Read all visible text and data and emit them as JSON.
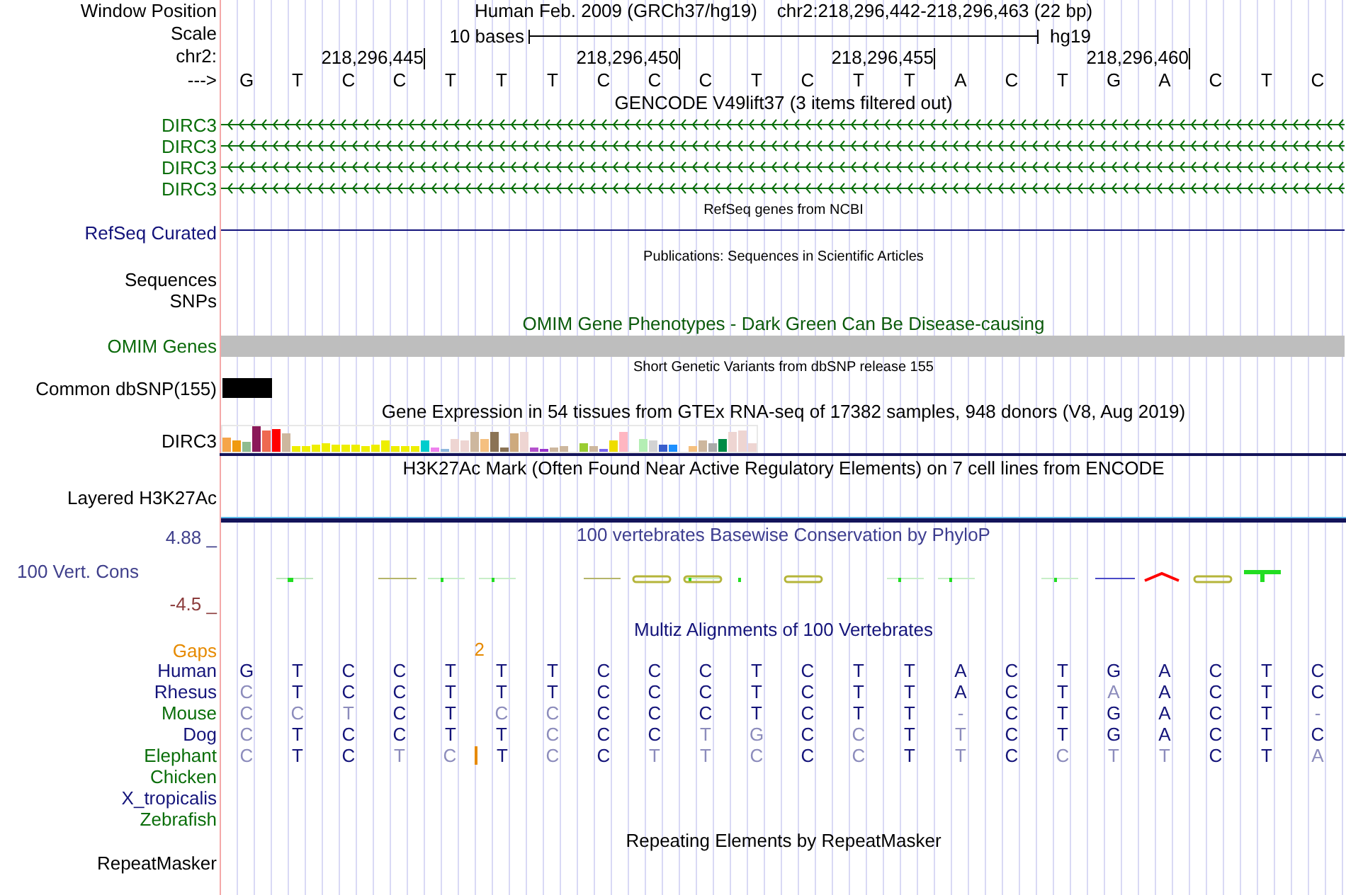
{
  "header": {
    "label": "Window Position",
    "assembly": "Human Feb. 2009 (GRCh37/hg19)",
    "position": "chr2:218,296,442-218,296,463 (22 bp)"
  },
  "scale": {
    "label": "Scale",
    "length": "10 bases",
    "assembly": "hg19"
  },
  "ruler": {
    "label": "chr2:",
    "ticks": [
      "218,296,445",
      "218,296,450",
      "218,296,455",
      "218,296,460"
    ]
  },
  "sequence": {
    "label": "--->",
    "bases": [
      "G",
      "T",
      "C",
      "C",
      "T",
      "T",
      "T",
      "C",
      "C",
      "C",
      "T",
      "C",
      "T",
      "T",
      "A",
      "C",
      "T",
      "G",
      "A",
      "C",
      "T",
      "C"
    ]
  },
  "tracks": [
    {
      "kind": "genes",
      "title": {
        "text": "GENCODE V49lift37 (3 items filtered out)",
        "color": "#000000"
      },
      "compact": false,
      "color": "#0a6e0a",
      "arrows": true,
      "rows": [
        "DIRC3",
        "DIRC3",
        "DIRC3",
        "DIRC3"
      ]
    },
    {
      "kind": "genes",
      "title": {
        "text": "RefSeq genes from NCBI",
        "color": "#000000"
      },
      "compact": true,
      "color": "#12127a",
      "arrows": false,
      "rows": [
        "RefSeq Curated"
      ]
    },
    {
      "kind": "labels",
      "title": {
        "text": "Publications: Sequences in Scientific Articles",
        "color": "#000000"
      },
      "compact": true,
      "rows": [
        "Sequences",
        "SNPs"
      ]
    },
    {
      "kind": "bar",
      "title": {
        "text": "OMIM Gene Phenotypes - Dark Green Can Be Disease-causing",
        "color": "#0b5a0b"
      },
      "compact": false,
      "color": "#0b6a0b",
      "bar": {
        "color": "#bebebe",
        "full": true
      },
      "rows": [
        "OMIM Genes"
      ]
    },
    {
      "kind": "bar",
      "title": {
        "text": "Short Genetic Variants from dbSNP release 155",
        "color": "#000000"
      },
      "compact": true,
      "color": "#000000",
      "bar": {
        "color": "#000000",
        "full": false
      },
      "rows": [
        "Common dbSNP(155)"
      ]
    },
    {
      "kind": "expression",
      "title": {
        "text": "Gene Expression in 54 tissues from GTEx RNA-seq of 17382 samples, 948 donors (V8, Aug 2019)",
        "color": "#000000"
      },
      "compact": false,
      "rows": [
        "DIRC3"
      ]
    },
    {
      "kind": "empty",
      "title": {
        "text": "H3K27Ac Mark (Often Found Near Active Regulatory Elements) on 7 cell lines from ENCODE",
        "color": "#000000"
      },
      "compact": false,
      "rows": [
        "Layered H3K27Ac"
      ]
    },
    {
      "kind": "wiggle",
      "title": {
        "text": "100 vertebrates Basewise Conservation by PhyloP",
        "color": "#3d3d8f"
      },
      "compact": false,
      "max": "4.88 _",
      "label": "100 Vert. Cons",
      "min": "-4.5 _"
    },
    {
      "kind": "alignment",
      "title": {
        "text": "Multiz Alignments of 100 Vertebrates",
        "color": "#14147a"
      },
      "compact": false,
      "gaps_label": "Gaps",
      "species": [
        {
          "name": "Human",
          "color": "#14147a",
          "bases": [
            {
              "base": "G",
              "match": true
            },
            {
              "base": "T",
              "match": true
            },
            {
              "base": "C",
              "match": true
            },
            {
              "base": "C",
              "match": true
            },
            {
              "base": "T",
              "match": true
            },
            {
              "base": "T",
              "match": true
            },
            {
              "base": "T",
              "match": true
            },
            {
              "base": "C",
              "match": true
            },
            {
              "base": "C",
              "match": true
            },
            {
              "base": "C",
              "match": true
            },
            {
              "base": "T",
              "match": true
            },
            {
              "base": "C",
              "match": true
            },
            {
              "base": "T",
              "match": true
            },
            {
              "base": "T",
              "match": true
            },
            {
              "base": "A",
              "match": true
            },
            {
              "base": "C",
              "match": true
            },
            {
              "base": "T",
              "match": true
            },
            {
              "base": "G",
              "match": true
            },
            {
              "base": "A",
              "match": true
            },
            {
              "base": "C",
              "match": true
            },
            {
              "base": "T",
              "match": true
            },
            {
              "base": "C",
              "match": true
            }
          ]
        },
        {
          "name": "Rhesus",
          "color": "#14147a",
          "bases": [
            {
              "base": "C",
              "match": false
            },
            {
              "base": "T",
              "match": true
            },
            {
              "base": "C",
              "match": true
            },
            {
              "base": "C",
              "match": true
            },
            {
              "base": "T",
              "match": true
            },
            {
              "base": "T",
              "match": true
            },
            {
              "base": "T",
              "match": true
            },
            {
              "base": "C",
              "match": true
            },
            {
              "base": "C",
              "match": true
            },
            {
              "base": "C",
              "match": true
            },
            {
              "base": "T",
              "match": true
            },
            {
              "base": "C",
              "match": true
            },
            {
              "base": "T",
              "match": true
            },
            {
              "base": "T",
              "match": true
            },
            {
              "base": "A",
              "match": true
            },
            {
              "base": "C",
              "match": true
            },
            {
              "base": "T",
              "match": true
            },
            {
              "base": "A",
              "match": false
            },
            {
              "base": "A",
              "match": true
            },
            {
              "base": "C",
              "match": true
            },
            {
              "base": "T",
              "match": true
            },
            {
              "base": "C",
              "match": true
            }
          ]
        },
        {
          "name": "Mouse",
          "color": "#0a6e0a",
          "bases": [
            {
              "base": "C",
              "match": false
            },
            {
              "base": "C",
              "match": false
            },
            {
              "base": "T",
              "match": false
            },
            {
              "base": "C",
              "match": true
            },
            {
              "base": "T",
              "match": true
            },
            {
              "base": "C",
              "match": false
            },
            {
              "base": "C",
              "match": false
            },
            {
              "base": "C",
              "match": true
            },
            {
              "base": "C",
              "match": true
            },
            {
              "base": "C",
              "match": true
            },
            {
              "base": "T",
              "match": true
            },
            {
              "base": "C",
              "match": true
            },
            {
              "base": "T",
              "match": true
            },
            {
              "base": "T",
              "match": true
            },
            {
              "base": "-",
              "match": false
            },
            {
              "base": "C",
              "match": true
            },
            {
              "base": "T",
              "match": true
            },
            {
              "base": "G",
              "match": true
            },
            {
              "base": "A",
              "match": true
            },
            {
              "base": "C",
              "match": true
            },
            {
              "base": "T",
              "match": true
            },
            {
              "base": "-",
              "match": false
            }
          ]
        },
        {
          "name": "Dog",
          "color": "#14147a",
          "bases": [
            {
              "base": "C",
              "match": false
            },
            {
              "base": "T",
              "match": true
            },
            {
              "base": "C",
              "match": true
            },
            {
              "base": "C",
              "match": true
            },
            {
              "base": "T",
              "match": true
            },
            {
              "base": "T",
              "match": true
            },
            {
              "base": "C",
              "match": false
            },
            {
              "base": "C",
              "match": true
            },
            {
              "base": "C",
              "match": true
            },
            {
              "base": "T",
              "match": false
            },
            {
              "base": "G",
              "match": false
            },
            {
              "base": "C",
              "match": true
            },
            {
              "base": "C",
              "match": false
            },
            {
              "base": "T",
              "match": true
            },
            {
              "base": "T",
              "match": false
            },
            {
              "base": "C",
              "match": true
            },
            {
              "base": "T",
              "match": true
            },
            {
              "base": "G",
              "match": true
            },
            {
              "base": "A",
              "match": true
            },
            {
              "base": "C",
              "match": true
            },
            {
              "base": "T",
              "match": true
            },
            {
              "base": "C",
              "match": true
            }
          ]
        },
        {
          "name": "Elephant",
          "color": "#0a6e0a",
          "bases": [
            {
              "base": "C",
              "match": false
            },
            {
              "base": "T",
              "match": true
            },
            {
              "base": "C",
              "match": true
            },
            {
              "base": "T",
              "match": false
            },
            {
              "base": "C",
              "match": false,
              "insertion": "2"
            },
            {
              "base": "T",
              "match": true
            },
            {
              "base": "C",
              "match": false
            },
            {
              "base": "C",
              "match": true
            },
            {
              "base": "T",
              "match": false
            },
            {
              "base": "T",
              "match": false
            },
            {
              "base": "C",
              "match": false
            },
            {
              "base": "C",
              "match": true
            },
            {
              "base": "C",
              "match": false
            },
            {
              "base": "T",
              "match": true
            },
            {
              "base": "T",
              "match": false
            },
            {
              "base": "C",
              "match": true
            },
            {
              "base": "C",
              "match": false
            },
            {
              "base": "T",
              "match": false
            },
            {
              "base": "T",
              "match": false
            },
            {
              "base": "C",
              "match": true
            },
            {
              "base": "T",
              "match": true
            },
            {
              "base": "A",
              "match": false
            }
          ]
        },
        {
          "name": "Chicken",
          "color": "#0a6e0a"
        },
        {
          "name": "X_tropicalis",
          "color": "#14147a"
        },
        {
          "name": "Zebrafish",
          "color": "#0a6e0a"
        }
      ]
    },
    {
      "kind": "labels",
      "title": {
        "text": "Repeating Elements by RepeatMasker",
        "color": "#000000"
      },
      "compact": false,
      "rows": [
        "RepeatMasker"
      ]
    }
  ]
}
